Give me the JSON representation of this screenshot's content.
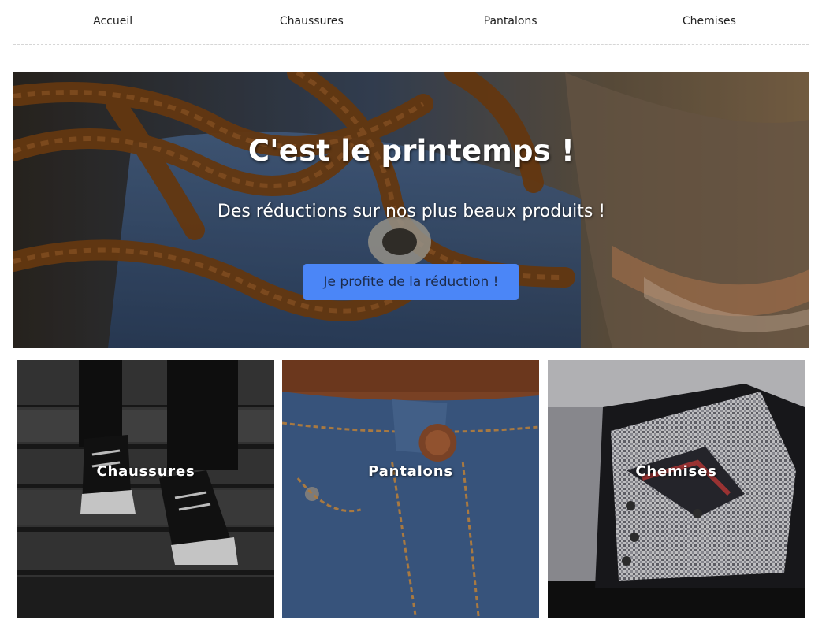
{
  "nav": {
    "items": [
      {
        "label": "Accueil"
      },
      {
        "label": "Chaussures"
      },
      {
        "label": "Pantalons"
      },
      {
        "label": "Chemises"
      }
    ]
  },
  "hero": {
    "title": "C'est le printemps !",
    "subtitle": "Des réductions sur nos plus beaux produits !",
    "cta_label": "Je profite de la réduction !",
    "accent_color": "#4b86f7"
  },
  "categories": [
    {
      "label": "Chaussures"
    },
    {
      "label": "Pantalons"
    },
    {
      "label": "Chemises"
    }
  ]
}
